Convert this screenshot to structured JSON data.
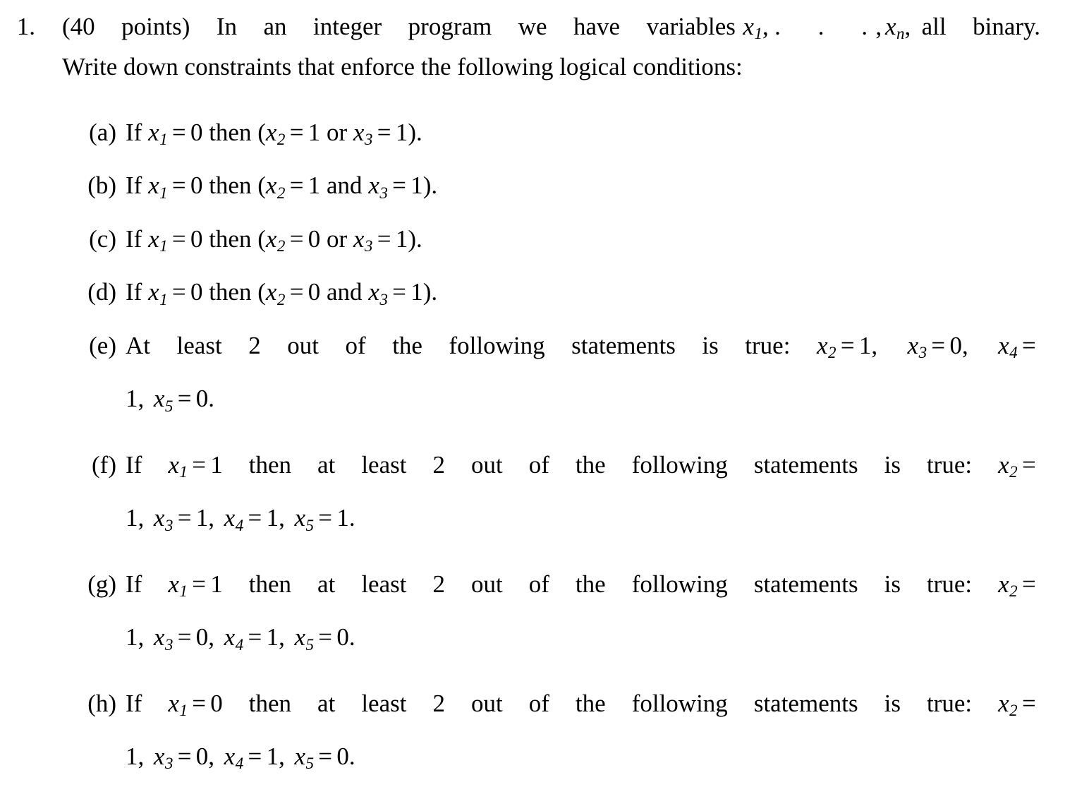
{
  "document": {
    "type": "homework-problem",
    "background_color": "#ffffff",
    "text_color": "#000000"
  },
  "problem": {
    "marker": "1.",
    "intro_line_1": "(40 points) In an integer program we have variables x1, . . . , xn, all binary.",
    "intro_line_2": "Write down constraints that enforce the following logical conditions:",
    "points": "40 points",
    "intro_prefix": "(40 points) In an integer program we have variables",
    "variables_list": "x1, . . . , xn,",
    "intro_suffix": "all binary.",
    "intro_second": "Write down constraints that enforce the following logical conditions:"
  },
  "subitems": [
    {
      "marker": "(a)",
      "text": "If x1 = 0 then (x2 = 1 or x3 = 1).",
      "lines": [
        "If x1 = 0 then (x2 = 1 or x3 = 1)."
      ],
      "wraps": false
    },
    {
      "marker": "(b)",
      "text": "If x1 = 0 then (x2 = 1 and x3 = 1).",
      "lines": [
        "If x1 = 0 then (x2 = 1 and x3 = 1)."
      ],
      "wraps": false
    },
    {
      "marker": "(c)",
      "text": "If x1 = 0 then (x2 = 0 or x3 = 1).",
      "lines": [
        "If x1 = 0 then (x2 = 0 or x3 = 1)."
      ],
      "wraps": false
    },
    {
      "marker": "(d)",
      "text": "If x1 = 0 then (x2 = 0 and x3 = 1).",
      "lines": [
        "If x1 = 0 then (x2 = 0 and x3 = 1)."
      ],
      "wraps": false
    },
    {
      "marker": "(e)",
      "text": "At least 2 out of the following statements is true: x2 = 1, x3 = 0, x4 = 1, x5 = 0.",
      "lines": [
        "At least 2 out of the following statements is true: x2 = 1, x3 = 0, x4 =",
        "1, x5 = 0."
      ],
      "wraps": true
    },
    {
      "marker": "(f)",
      "text": "If x1 = 1 then at least 2 out of the following statements is true: x2 = 1, x3 = 1, x4 = 1, x5 = 1.",
      "lines": [
        "If x1 = 1 then at least 2 out of the following statements is true: x2 =",
        "1, x3 = 1, x4 = 1, x5 = 1."
      ],
      "wraps": true
    },
    {
      "marker": "(g)",
      "text": "If x1 = 1 then at least 2 out of the following statements is true: x2 = 1, x3 = 0, x4 = 1, x5 = 0.",
      "lines": [
        "If x1 = 1 then at least 2 out of the following statements is true: x2 =",
        "1, x3 = 0, x4 = 1, x5 = 0."
      ],
      "wraps": true
    },
    {
      "marker": "(h)",
      "text": "If x1 = 0 then at least 2 out of the following statements is true: x2 = 1, x3 = 0, x4 = 1, x5 = 0.",
      "lines": [
        "If x1 = 0 then at least 2 out of the following statements is true: x2 =",
        "1, x3 = 0, x4 = 1, x5 = 0."
      ],
      "wraps": true
    }
  ]
}
